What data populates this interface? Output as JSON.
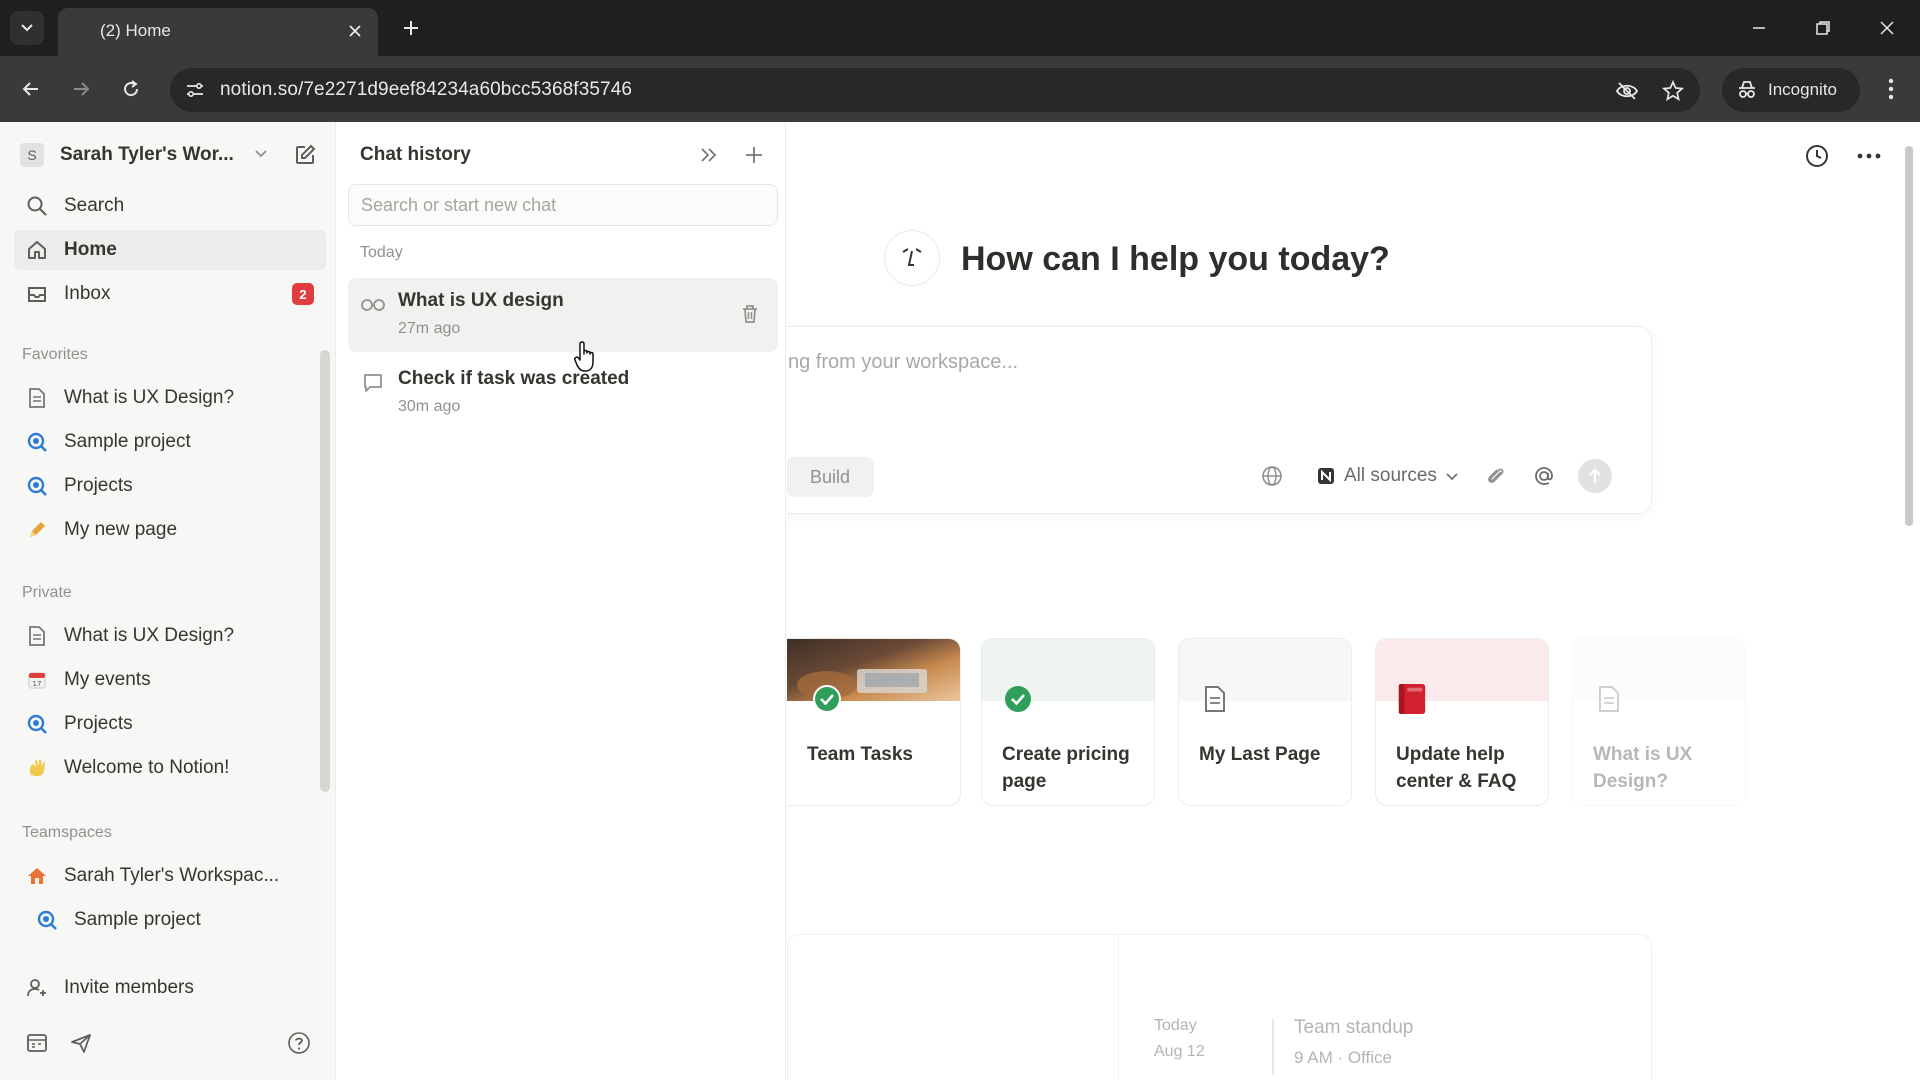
{
  "browser": {
    "tab_title": "(2) Home",
    "url": "notion.so/7e2271d9eef84234a60bcc5368f35746",
    "incognito_label": "Incognito"
  },
  "sidebar": {
    "workspace_initial": "S",
    "workspace_name": "Sarah Tyler's Wor...",
    "top_items": [
      {
        "label": "Search",
        "icon": "search-icon"
      },
      {
        "label": "Home",
        "icon": "home-icon"
      },
      {
        "label": "Inbox",
        "icon": "inbox-icon",
        "badge": "2"
      }
    ],
    "favorites_heading": "Favorites",
    "favorites": [
      {
        "label": "What is UX Design?",
        "icon": "page-icon"
      },
      {
        "label": "Sample project",
        "icon": "search-page-icon"
      },
      {
        "label": "Projects",
        "icon": "search-page-icon"
      },
      {
        "label": "My new page",
        "icon": "pencil-icon"
      }
    ],
    "private_heading": "Private",
    "private": [
      {
        "label": "What is UX Design?",
        "icon": "page-icon"
      },
      {
        "label": "My events",
        "icon": "calendar-icon"
      },
      {
        "label": "Projects",
        "icon": "search-page-icon"
      },
      {
        "label": "Welcome to Notion!",
        "icon": "wave-icon"
      }
    ],
    "teamspaces_heading": "Teamspaces",
    "teamspaces": [
      {
        "label": "Sarah Tyler's Workspac...",
        "icon": "house-icon"
      },
      {
        "label": "Sample project",
        "icon": "search-page-icon"
      }
    ],
    "invite_label": "Invite members"
  },
  "chat_history": {
    "title": "Chat history",
    "search_placeholder": "Search or start new chat",
    "group_label": "Today",
    "items": [
      {
        "title": "What is UX design",
        "time": "27m ago",
        "icon": "glasses-icon"
      },
      {
        "title": "Check if task was created",
        "time": "30m ago",
        "icon": "chat-bubble-icon"
      }
    ]
  },
  "main": {
    "greeting": "How can I help you today?",
    "ask_placeholder": "ng from your workspace...",
    "build_label": "Build",
    "sources_label": "All sources",
    "cards": [
      {
        "title": "Team Tasks",
        "icon": "check-circle-icon"
      },
      {
        "title": "Create pricing page",
        "icon": "check-circle-icon"
      },
      {
        "title": "My Last Page",
        "icon": "page-icon"
      },
      {
        "title": "Update help center & FAQ",
        "icon": "red-book-icon"
      },
      {
        "title": "What is UX Design?",
        "icon": "page-icon"
      }
    ],
    "calendar": {
      "day": "Today",
      "date": "Aug 12",
      "event_title": "Team standup",
      "event_detail": "9 AM · Office"
    }
  },
  "colors": {
    "badge": "#e03e3e",
    "check_green": "#2f9e5b",
    "red_book": "#d1202f",
    "sidebar_bg": "#f7f7f5"
  }
}
